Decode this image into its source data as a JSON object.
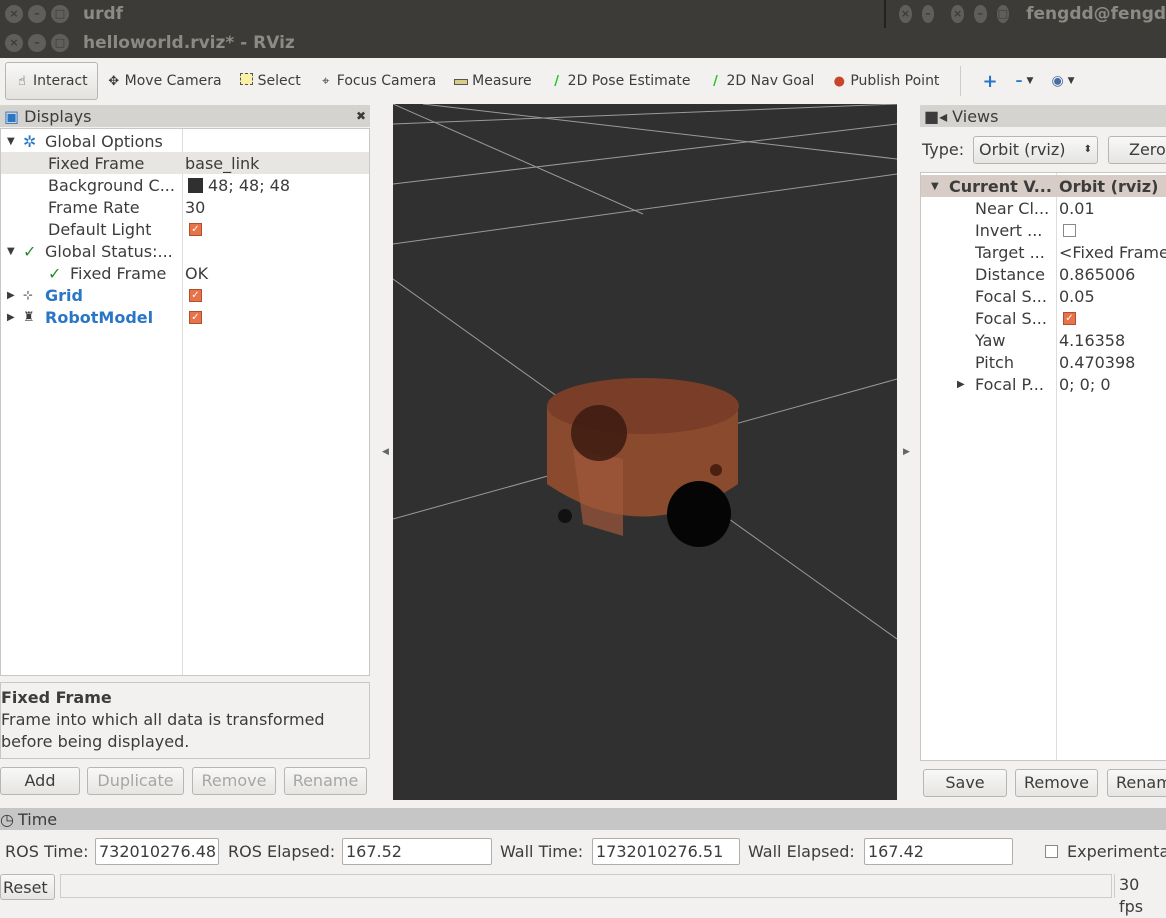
{
  "windows": {
    "back_title": "urdf",
    "back_title_right": "fengdd@fengd",
    "title": "helloworld.rviz* - RViz"
  },
  "toolbar": {
    "tools": [
      {
        "label": "Interact",
        "icon": "hand-icon",
        "active": true
      },
      {
        "label": "Move Camera",
        "icon": "move-camera-icon"
      },
      {
        "label": "Select",
        "icon": "select-icon"
      },
      {
        "label": "Focus Camera",
        "icon": "focus-camera-icon"
      },
      {
        "label": "Measure",
        "icon": "ruler-icon"
      },
      {
        "label": "2D Pose Estimate",
        "icon": "pose-arrow-icon"
      },
      {
        "label": "2D Nav Goal",
        "icon": "nav-goal-icon"
      },
      {
        "label": "Publish Point",
        "icon": "map-pin-icon"
      }
    ]
  },
  "displays": {
    "title": "Displays",
    "global_options": "Global Options",
    "fixed_frame_label": "Fixed Frame",
    "fixed_frame_value": "base_link",
    "background_label": "Background C...",
    "background_value": "48; 48; 48",
    "background_color": "#303030",
    "frame_rate_label": "Frame Rate",
    "frame_rate_value": "30",
    "default_light_label": "Default Light",
    "global_status": "Global Status:...",
    "status_fixed_frame": "Fixed Frame",
    "status_ok": "OK",
    "grid": "Grid",
    "robot_model": "RobotModel",
    "desc_title": "Fixed Frame",
    "desc_text": "Frame into which all data is transformed before being displayed.",
    "buttons": {
      "add": "Add",
      "duplicate": "Duplicate",
      "remove": "Remove",
      "rename": "Rename"
    }
  },
  "views": {
    "title": "Views",
    "type_label": "Type:",
    "type_value": "Orbit (rviz)",
    "zero": "Zero",
    "header_name": "Current V...",
    "header_value": "Orbit (rviz)",
    "props": [
      {
        "name": "Near Cl...",
        "value": "0.01"
      },
      {
        "name": "Invert ...",
        "value": "",
        "check": "off"
      },
      {
        "name": "Target ...",
        "value": "<Fixed Frame>"
      },
      {
        "name": "Distance",
        "value": "0.865006"
      },
      {
        "name": "Focal S...",
        "value": "0.05"
      },
      {
        "name": "Focal S...",
        "value": "",
        "check": "on"
      },
      {
        "name": "Yaw",
        "value": "4.16358"
      },
      {
        "name": "Pitch",
        "value": "0.470398"
      },
      {
        "name": "Focal P...",
        "value": "0; 0; 0"
      }
    ],
    "buttons": {
      "save": "Save",
      "remove": "Remove",
      "rename": "Renam"
    }
  },
  "time": {
    "title": "Time",
    "ros_time_label": "ROS Time:",
    "ros_time": "732010276.48",
    "ros_elapsed_label": "ROS Elapsed:",
    "ros_elapsed": "167.52",
    "wall_time_label": "Wall Time:",
    "wall_time": "1732010276.51",
    "wall_elapsed_label": "Wall Elapsed:",
    "wall_elapsed": "167.42",
    "experimental": "Experimenta"
  },
  "status": {
    "reset": "Reset",
    "fps": "30 fps"
  }
}
